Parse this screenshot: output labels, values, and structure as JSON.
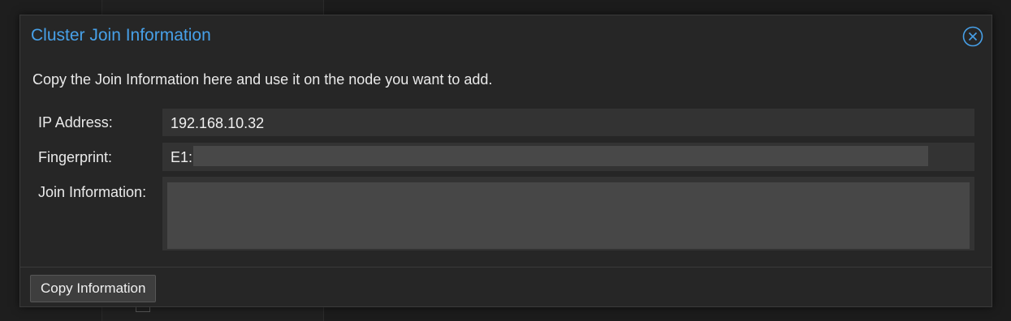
{
  "dialog": {
    "title": "Cluster Join Information",
    "close_icon": "close-circle-icon",
    "description": "Copy the Join Information here and use it on the node you want to add.",
    "fields": {
      "ip_address": {
        "label": "IP Address:",
        "value": "192.168.10.32"
      },
      "fingerprint": {
        "label": "Fingerprint:",
        "value": "E1:"
      },
      "join_information": {
        "label": "Join Information:",
        "value": ""
      }
    },
    "footer": {
      "copy_button_label": "Copy Information"
    }
  },
  "colors": {
    "accent": "#47a0e8",
    "dialog_bg": "#262626",
    "field_bg": "#333333",
    "redacted_bg": "#484848"
  }
}
